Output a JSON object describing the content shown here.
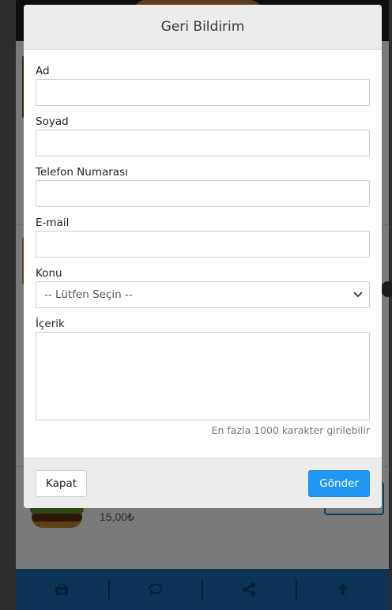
{
  "modal": {
    "title": "Geri Bildirim",
    "fields": {
      "first_name": {
        "label": "Ad",
        "value": ""
      },
      "last_name": {
        "label": "Soyad",
        "value": ""
      },
      "phone": {
        "label": "Telefon Numarası",
        "value": ""
      },
      "email": {
        "label": "E-mail",
        "value": ""
      },
      "subject": {
        "label": "Konu",
        "selected": "-- Lütfen Seçin --"
      },
      "content": {
        "label": "İçerik",
        "value": "",
        "help": "En fazla 1000 karakter girilebilir"
      }
    },
    "footer": {
      "close_label": "Kapat",
      "send_label": "Gönder"
    }
  },
  "background": {
    "product_price": "15,00₺"
  },
  "bottom_nav": {
    "icons": [
      "basket-icon",
      "comment-icon",
      "share-icon",
      "arrow-up-icon"
    ]
  },
  "colors": {
    "primary": "#2196f3",
    "bottom_bar": "#1668ad",
    "modal_header": "#ececec"
  }
}
